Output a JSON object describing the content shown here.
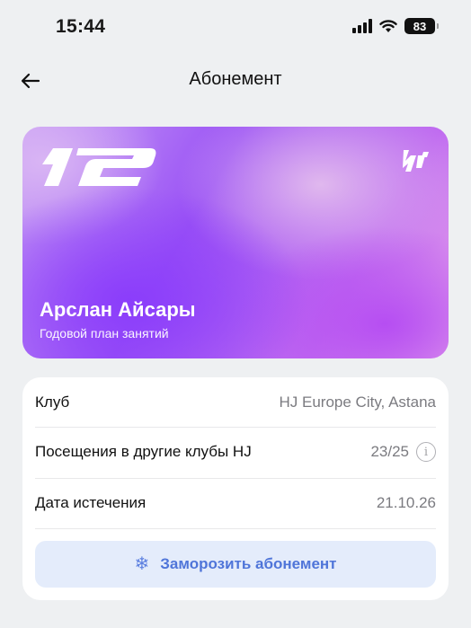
{
  "status_bar": {
    "time": "15:44",
    "battery": "83"
  },
  "navbar": {
    "back_icon": "arrow-left-icon",
    "title": "Абонемент"
  },
  "card": {
    "logo_text": "12",
    "brand_logo": "hj-brand-icon",
    "owner_name": "Арслан Айсары",
    "plan": "Годовой план занятий",
    "colors": {
      "violet": "#8b3dfb",
      "magenta": "#b64ef2",
      "pink": "#e9a6ea"
    }
  },
  "details": {
    "rows": [
      {
        "label": "Клуб",
        "value": "HJ Europe City, Astana"
      },
      {
        "label": "Посещения в другие клубы HJ",
        "value": "23/25",
        "info_icon": "info-icon"
      },
      {
        "label": "Дата истечения",
        "value": "21.10.26"
      }
    ],
    "freeze_button": {
      "icon": "snowflake-icon",
      "label": "Заморозить абонемент"
    }
  },
  "colors": {
    "background": "#eef0f2",
    "accent": "#4f75d9",
    "button_bg": "#e4ecfb"
  }
}
